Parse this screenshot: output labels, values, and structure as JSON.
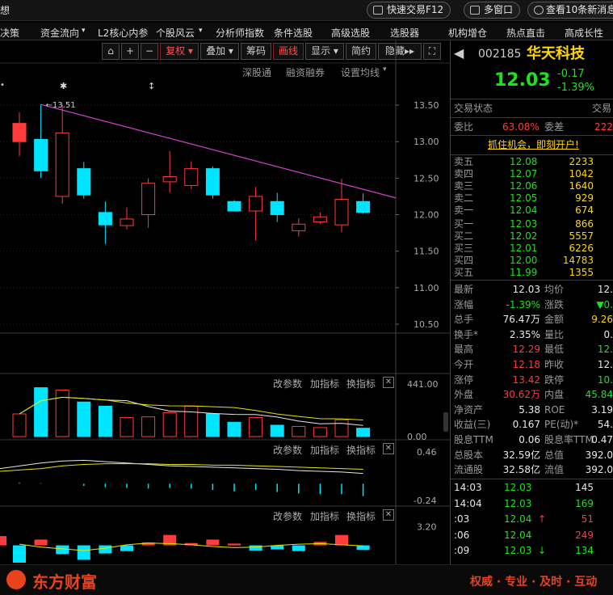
{
  "topbar": {
    "left_text": "想",
    "quick_trade": "快速交易F12",
    "multi_window": "多窗口",
    "news": "查看10条新消息"
  },
  "nav": [
    "决策",
    "资金流向",
    "L2核心内参",
    "个股风云",
    "分析师指数",
    "条件选股",
    "高级选股",
    "选股器",
    "机构增仓",
    "热点直击",
    "高成长性"
  ],
  "toolbar": {
    "fuquan": "复权",
    "diejia": "叠加",
    "chouma": "筹码",
    "huaxian": "画线",
    "xianshi": "显示",
    "jianyue": "简约",
    "yincang": "隐藏"
  },
  "chart_links": {
    "shengutong": "深股通",
    "rongzi": "融资融券",
    "settings": "设置均线"
  },
  "panel_buttons": {
    "modify": "改参数",
    "add": "加指标",
    "switch": "换指标"
  },
  "chart_data": {
    "type": "candlestick",
    "annotation": "13.51",
    "y_ticks": [
      "13.50",
      "13.00",
      "12.50",
      "12.00",
      "11.50",
      "11.00",
      "10.50"
    ],
    "ylim": [
      10.4,
      13.7
    ],
    "candles": [
      {
        "o": 13.25,
        "c": 13.0,
        "h": 13.4,
        "l": 12.8,
        "color": "#ff3b3b"
      },
      {
        "o": 13.03,
        "c": 12.6,
        "h": 13.51,
        "l": 12.5,
        "color": "#00e5ff"
      },
      {
        "o": 12.25,
        "c": 13.12,
        "h": 13.51,
        "l": 12.15,
        "color": "#ff3b3b"
      },
      {
        "o": 12.63,
        "c": 12.27,
        "h": 12.72,
        "l": 12.22,
        "color": "#00e5ff"
      },
      {
        "o": 12.03,
        "c": 11.86,
        "h": 12.18,
        "l": 11.6,
        "color": "#00e5ff"
      },
      {
        "o": 11.85,
        "c": 11.94,
        "h": 12.1,
        "l": 11.8,
        "color": "#ff3b3b"
      },
      {
        "o": 12.0,
        "c": 12.43,
        "h": 12.5,
        "l": 11.82,
        "color": "#ff3b3b"
      },
      {
        "o": 12.45,
        "c": 12.52,
        "h": 12.87,
        "l": 12.3,
        "color": "#ff3b3b"
      },
      {
        "o": 12.4,
        "c": 12.63,
        "h": 12.73,
        "l": 12.35,
        "color": "#ff3b3b"
      },
      {
        "o": 12.63,
        "c": 12.27,
        "h": 12.66,
        "l": 12.22,
        "color": "#00e5ff"
      },
      {
        "o": 12.18,
        "c": 12.05,
        "h": 12.2,
        "l": 12.05,
        "color": "#00e5ff"
      },
      {
        "o": 12.05,
        "c": 12.25,
        "h": 12.38,
        "l": 11.65,
        "color": "#ff3b3b"
      },
      {
        "o": 12.18,
        "c": 12.0,
        "h": 12.3,
        "l": 11.9,
        "color": "#00e5ff"
      },
      {
        "o": 11.78,
        "c": 11.87,
        "h": 11.95,
        "l": 11.7,
        "color": "#ff3b3b"
      },
      {
        "o": 11.9,
        "c": 11.97,
        "h": 12.03,
        "l": 11.87,
        "color": "#ff3b3b"
      },
      {
        "o": 11.86,
        "c": 12.21,
        "h": 12.49,
        "l": 11.76,
        "color": "#ff3b3b"
      },
      {
        "o": 12.18,
        "c": 12.03,
        "h": 12.29,
        "l": 12.01,
        "color": "#00e5ff"
      }
    ],
    "volume": {
      "max_label": "441.00",
      "zero_label": "0.00",
      "ymax": 441,
      "values": [
        190,
        410,
        390,
        290,
        255,
        160,
        165,
        200,
        255,
        190,
        120,
        160,
        95,
        85,
        75,
        140,
        70
      ],
      "colors": [
        "#ff3b3b",
        "#00e5ff",
        "#ff3b3b",
        "#00e5ff",
        "#00e5ff",
        "#ff3b3b",
        "#ff3b3b",
        "#ff3b3b",
        "#ff3b3b",
        "#00e5ff",
        "#00e5ff",
        "#ff3b3b",
        "#00e5ff",
        "#ff3b3b",
        "#ff3b3b",
        "#ff3b3b",
        "#00e5ff"
      ]
    },
    "macd": {
      "top_label": "0.46",
      "bottom_label": "-0.24",
      "ylim": [
        -0.3,
        0.52
      ],
      "bars": [
        0.02,
        0.01,
        0.0,
        -0.03,
        -0.05,
        -0.06,
        -0.07,
        -0.06,
        -0.07,
        -0.09,
        -0.11,
        -0.09,
        -0.12,
        -0.14,
        -0.15,
        -0.15,
        -0.18
      ]
    },
    "third": {
      "label": "3.20",
      "ylim": [
        -3,
        4
      ],
      "bars": [
        1.6,
        -3,
        1.0,
        -1.5,
        -2.5,
        -1.4,
        -1.0,
        0.5,
        1.8,
        0.4,
        1.0,
        0.3,
        -0.9,
        -0.7,
        -1.0,
        0.6,
        1.8,
        -0.8
      ],
      "colors": [
        "#ff3b3b",
        "#00e5ff",
        "#ff3b3b",
        "#00e5ff",
        "#00e5ff",
        "#00e5ff",
        "#00e5ff",
        "#ff3b3b",
        "#ff3b3b",
        "#ff3b3b",
        "#ff3b3b",
        "#ff3b3b",
        "#00e5ff",
        "#00e5ff",
        "#00e5ff",
        "#ff3b3b",
        "#ff3b3b",
        "#00e5ff"
      ]
    }
  },
  "quote": {
    "code": "002185",
    "name": "华天科技",
    "price": "12.03",
    "change": "-0.17",
    "pct": "-1.39%",
    "trade_status": "交易状态",
    "trade_status_right": "交易",
    "weibi_label": "委比",
    "weibi_val": "63.08%",
    "weicha_label": "委差",
    "weicha_val": "222",
    "ad": "抓住机会，即刻开户!",
    "asks": [
      [
        "卖五",
        "12.08",
        "2233"
      ],
      [
        "卖四",
        "12.07",
        "1042"
      ],
      [
        "卖三",
        "12.06",
        "1640"
      ],
      [
        "卖二",
        "12.05",
        "929"
      ],
      [
        "卖一",
        "12.04",
        "674"
      ]
    ],
    "bids": [
      [
        "买一",
        "12.03",
        "866"
      ],
      [
        "买二",
        "12.02",
        "5557"
      ],
      [
        "买三",
        "12.01",
        "6226"
      ],
      [
        "买四",
        "12.00",
        "14783"
      ],
      [
        "买五",
        "11.99",
        "1355"
      ]
    ],
    "stats": [
      [
        "最新",
        "12.03",
        "wht",
        "均价",
        "12.",
        "wht"
      ],
      [
        "涨幅",
        "-1.39%",
        "grn",
        "涨跌",
        "▼0.",
        "grn"
      ],
      [
        "总手",
        "76.47万",
        "wht",
        "金额",
        "9.26",
        "yel"
      ],
      [
        "换手*",
        "2.35%",
        "wht",
        "量比",
        "0.",
        "wht"
      ],
      [
        "最高",
        "12.29",
        "red",
        "最低",
        "12.",
        "grn"
      ],
      [
        "今开",
        "12.18",
        "red",
        "昨收",
        "12.",
        "wht"
      ],
      [
        "涨停",
        "13.42",
        "red",
        "跌停",
        "10.",
        "grn"
      ],
      [
        "外盘",
        "30.62万",
        "red",
        "内盘",
        "45.84",
        "grn"
      ],
      [
        "净资产",
        "5.38",
        "wht",
        "ROE",
        "3.19",
        "wht"
      ],
      [
        "收益(三)",
        "0.167",
        "wht",
        "PE(动)*",
        "54.",
        "wht"
      ],
      [
        "股息TTM",
        "0.06",
        "wht",
        "股息率TTM",
        "0.47",
        "wht"
      ],
      [
        "总股本",
        "32.59亿",
        "wht",
        "总值",
        "392.0",
        "wht"
      ],
      [
        "流通股",
        "32.58亿",
        "wht",
        "流值",
        "392.0",
        "wht"
      ]
    ],
    "ticks": [
      [
        "14:03",
        "12.03",
        "145",
        "",
        "wht"
      ],
      [
        "14:04",
        "12.03",
        "169",
        "",
        "grn"
      ],
      [
        ":03",
        "12.04",
        "51",
        "↑",
        "red"
      ],
      [
        ":06",
        "12.04",
        "249",
        "",
        "red"
      ],
      [
        ":09",
        "12.03",
        "134",
        "↓",
        "grn"
      ]
    ]
  },
  "footer": {
    "brand": "东方财富",
    "slogan": "权威 · 专业 · 及时 · 互动"
  }
}
